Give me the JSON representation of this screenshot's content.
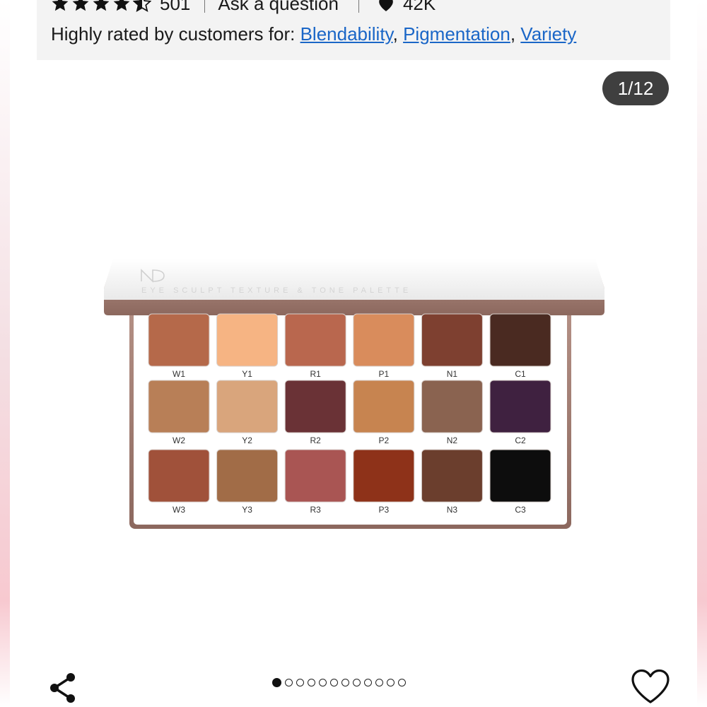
{
  "rating": {
    "stars_value": 4.5,
    "review_count": "501",
    "ask_label": "Ask a question",
    "likes": "42K"
  },
  "highlights": {
    "prefix": "Highly rated by customers for: ",
    "tags": [
      "Blendability",
      "Pigmentation",
      "Variety"
    ],
    "separators": [
      ", ",
      ", "
    ]
  },
  "gallery": {
    "counter": "1/12",
    "total_images": 12,
    "active_index": 0
  },
  "palette": {
    "lid_text": "EYE SCULPT TEXTURE & TONE PALETTE",
    "rows": [
      [
        {
          "label": "W1",
          "color": "#b5694a"
        },
        {
          "label": "Y1",
          "color": "#f6b483"
        },
        {
          "label": "R1",
          "color": "#b9674e"
        },
        {
          "label": "P1",
          "color": "#d98c5c"
        },
        {
          "label": "N1",
          "color": "#7e4030"
        },
        {
          "label": "C1",
          "color": "#4a2a21"
        }
      ],
      [
        {
          "label": "W2",
          "color": "#b87f57"
        },
        {
          "label": "Y2",
          "color": "#d9a57c"
        },
        {
          "label": "R2",
          "color": "#6a3236"
        },
        {
          "label": "P2",
          "color": "#c78450"
        },
        {
          "label": "N2",
          "color": "#8a6350"
        },
        {
          "label": "C2",
          "color": "#3f2140"
        }
      ],
      [
        {
          "label": "W3",
          "color": "#a0513a"
        },
        {
          "label": "Y3",
          "color": "#a16c47"
        },
        {
          "label": "R3",
          "color": "#a95553"
        },
        {
          "label": "P3",
          "color": "#8e3219"
        },
        {
          "label": "N3",
          "color": "#6b3e2d"
        },
        {
          "label": "C3",
          "color": "#0d0d0d"
        }
      ]
    ]
  },
  "icons": {
    "share": "share-icon",
    "favorite": "heart-outline-icon",
    "likes": "heart-filled-icon",
    "rating": "star-icon"
  }
}
